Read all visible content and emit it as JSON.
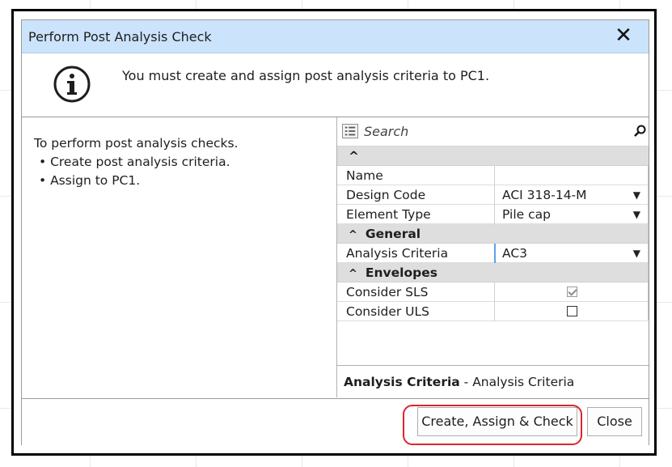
{
  "dialog": {
    "title": "Perform Post Analysis Check",
    "close_glyph": "✕",
    "message": "You must create and assign post analysis criteria to PC1."
  },
  "instructions": {
    "heading": "To perform post analysis checks.",
    "bullets": [
      "• Create post analysis criteria.",
      "• Assign to PC1."
    ]
  },
  "property_grid": {
    "search_placeholder": "Search",
    "rows": {
      "top_group_caret": "^",
      "name_label": "Name",
      "name_value": "",
      "design_code_label": "Design Code",
      "design_code_value": "ACI 318-14-M",
      "element_type_label": "Element Type",
      "element_type_value": "Pile cap",
      "general_group": "General",
      "analysis_criteria_label": "Analysis Criteria",
      "analysis_criteria_value": "AC3",
      "envelopes_group": "Envelopes",
      "consider_sls_label": "Consider SLS",
      "consider_sls_checked": true,
      "consider_uls_label": "Consider ULS",
      "consider_uls_checked": false
    },
    "description": {
      "bold": "Analysis Criteria",
      "rest": " - Analysis Criteria"
    }
  },
  "footer": {
    "create_button": "Create, Assign & Check",
    "close_button": "Close"
  },
  "icons": {
    "info": "info-icon",
    "list": "list-icon",
    "search": "search-icon",
    "dropdown": "chevron-down-icon",
    "collapse": "caret-up-icon"
  },
  "colors": {
    "titlebar": "#cbe3fb",
    "highlight": "#d9262c",
    "selection_accent": "#5aa3e8"
  }
}
